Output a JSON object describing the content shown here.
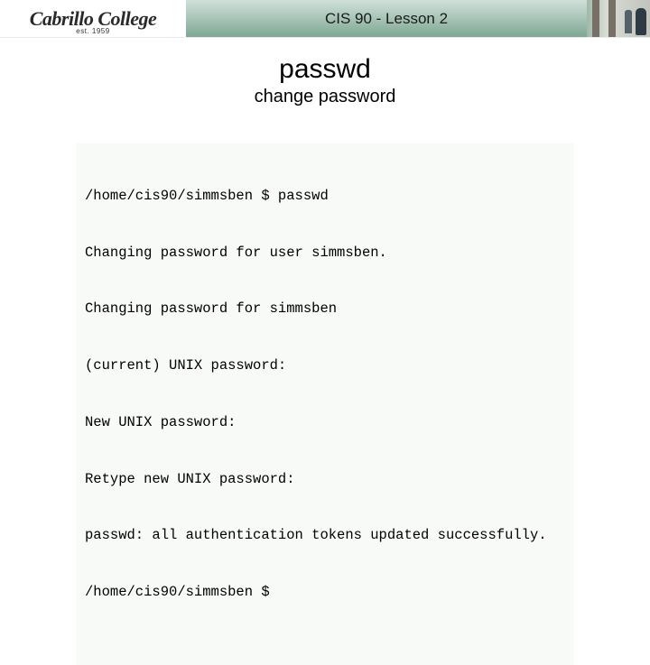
{
  "banner": {
    "logo_text": "Cabrillo College",
    "logo_est": "est. 1959",
    "title": "CIS 90 - Lesson 2"
  },
  "heading": {
    "command": "passwd",
    "subtitle": "change password"
  },
  "terminal": {
    "lines": [
      "/home/cis90/simmsben $ passwd",
      "Changing password for user simmsben.",
      "Changing password for simmsben",
      "(current) UNIX password:",
      "New UNIX password:",
      "Retype new UNIX password:",
      "passwd: all authentication tokens updated successfully.",
      "/home/cis90/simmsben $"
    ]
  }
}
